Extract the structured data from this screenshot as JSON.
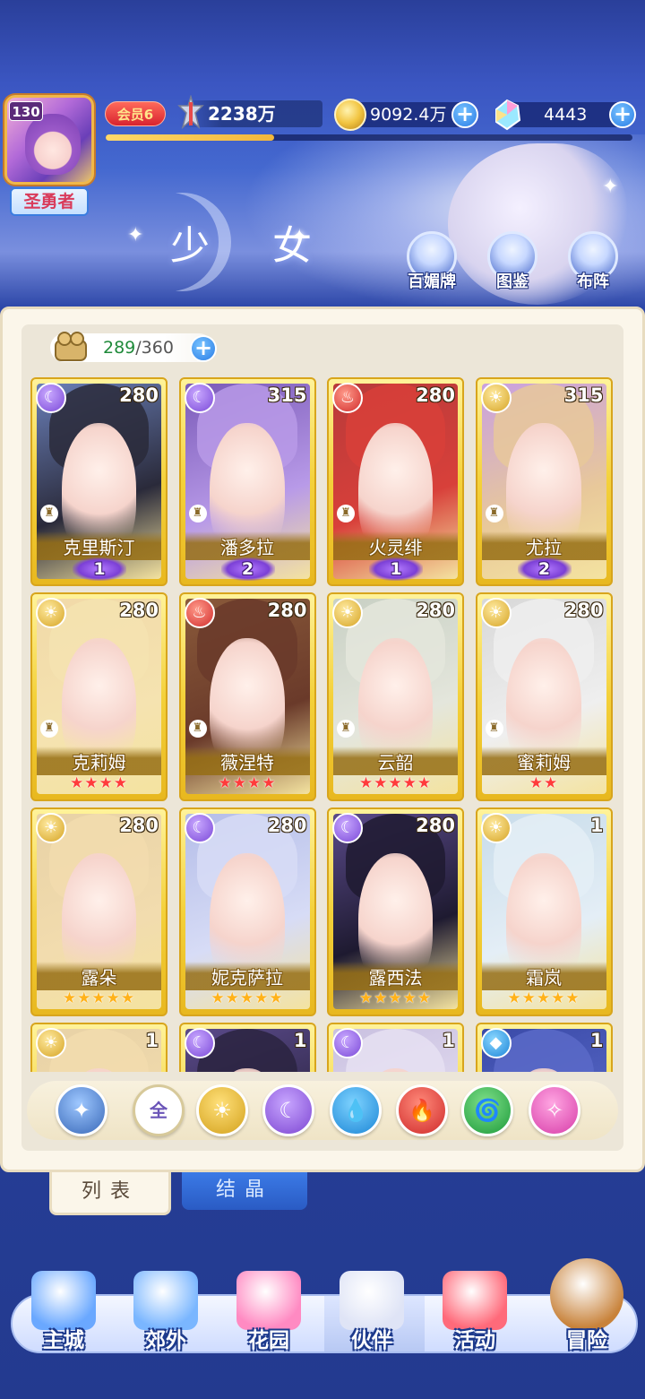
{
  "player": {
    "level": "130",
    "title": "圣勇者",
    "vip": "会员6",
    "power": "2238万",
    "exp_progress": 0.32
  },
  "resources": {
    "gold": "9092.4万",
    "gems": "4443"
  },
  "page": {
    "title": "少 女"
  },
  "side_buttons": [
    {
      "label": "百媚牌",
      "icon": "card-deck-icon"
    },
    {
      "label": "图鉴",
      "icon": "book-icon"
    },
    {
      "label": "布阵",
      "icon": "formation-grid-icon"
    }
  ],
  "roster": {
    "current": "289",
    "max": "/360"
  },
  "cards": [
    {
      "name": "克里斯汀",
      "level": "280",
      "element": "moon",
      "rank": "1",
      "stars": "",
      "star_color": ""
    },
    {
      "name": "潘多拉",
      "level": "315",
      "element": "moon",
      "rank": "2",
      "stars": "",
      "star_color": ""
    },
    {
      "name": "火灵绯",
      "level": "280",
      "element": "fire",
      "rank": "1",
      "stars": "",
      "star_color": ""
    },
    {
      "name": "尤拉",
      "level": "315",
      "element": "sun",
      "rank": "2",
      "stars": "",
      "star_color": ""
    },
    {
      "name": "克莉姆",
      "level": "280",
      "element": "sun",
      "rank": "",
      "stars": "★★★★",
      "star_color": "red"
    },
    {
      "name": "薇涅特",
      "level": "280",
      "element": "fire",
      "rank": "",
      "stars": "★★★★",
      "star_color": "red"
    },
    {
      "name": "云韶",
      "level": "280",
      "element": "sun",
      "rank": "",
      "stars": "★★★★★",
      "star_color": "red"
    },
    {
      "name": "蜜莉姆",
      "level": "280",
      "element": "sun",
      "rank": "",
      "stars": "★★",
      "star_color": "red"
    },
    {
      "name": "露朵",
      "level": "280",
      "element": "sun",
      "rank": "",
      "stars": "★★★★★",
      "star_color": "gold"
    },
    {
      "name": "妮克萨拉",
      "level": "280",
      "element": "moon",
      "rank": "",
      "stars": "★★★★★",
      "star_color": "gold"
    },
    {
      "name": "露西法",
      "level": "280",
      "element": "moon",
      "rank": "",
      "stars": "★★★★★",
      "star_color": "gold"
    },
    {
      "name": "霜岚",
      "level": "1",
      "element": "sun",
      "rank": "",
      "stars": "★★★★★",
      "star_color": "gold"
    },
    {
      "name": "",
      "level": "1",
      "element": "sun",
      "rank": "",
      "stars": "",
      "star_color": ""
    },
    {
      "name": "",
      "level": "1",
      "element": "moon",
      "rank": "",
      "stars": "",
      "star_color": ""
    },
    {
      "name": "",
      "level": "1",
      "element": "moon",
      "rank": "",
      "stars": "",
      "star_color": ""
    },
    {
      "name": "",
      "level": "1",
      "element": "water",
      "rank": "",
      "stars": "",
      "star_color": ""
    }
  ],
  "filters": [
    {
      "id": "upgrade",
      "label": "✦"
    },
    {
      "id": "all",
      "label": "全"
    },
    {
      "id": "sun",
      "label": "☀"
    },
    {
      "id": "moon",
      "label": "☾"
    },
    {
      "id": "water",
      "label": "💧"
    },
    {
      "id": "fire",
      "label": "🔥"
    },
    {
      "id": "wind",
      "label": "🌀"
    },
    {
      "id": "star",
      "label": "✧"
    }
  ],
  "tabs": {
    "list": "列表",
    "crystal": "结晶"
  },
  "nav": [
    {
      "label": "主城",
      "icon": "castle-icon"
    },
    {
      "label": "郊外",
      "icon": "magic-circle-icon"
    },
    {
      "label": "花园",
      "icon": "heart-garden-icon"
    },
    {
      "label": "伙伴",
      "icon": "partner-icon"
    },
    {
      "label": "活动",
      "icon": "gift-icon"
    },
    {
      "label": "冒险",
      "icon": "compass-icon"
    }
  ]
}
